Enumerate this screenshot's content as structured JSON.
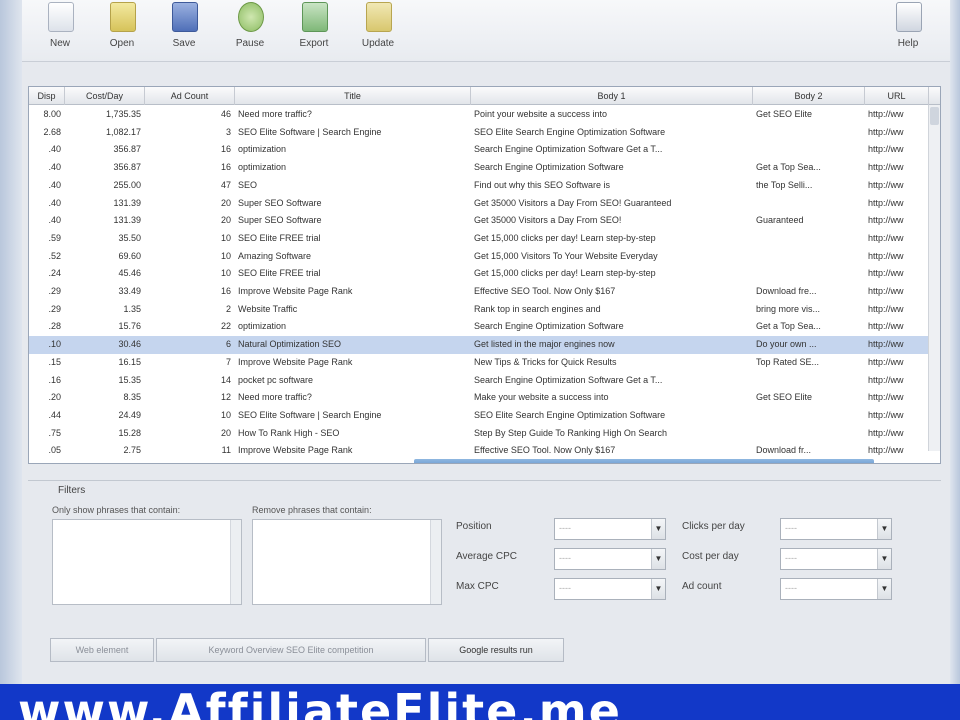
{
  "toolbar": {
    "buttons": [
      {
        "label": "New",
        "icon": "new-file-icon"
      },
      {
        "label": "Open",
        "icon": "open-folder-icon"
      },
      {
        "label": "Save",
        "icon": "save-disk-icon"
      },
      {
        "label": "Pause",
        "icon": "pause-icon"
      },
      {
        "label": "Export",
        "icon": "export-icon"
      },
      {
        "label": "Update",
        "icon": "update-icon"
      }
    ],
    "help_label": "Help"
  },
  "grid": {
    "columns": [
      "Disp",
      "Cost/Day",
      "Ad Count",
      "Title",
      "Body 1",
      "Body 2",
      "URL"
    ],
    "rows": [
      [
        "8.00",
        "1,735.35",
        "46",
        "Need more traffic?",
        "Point your website a success into",
        "Get SEO Elite",
        "http://ww"
      ],
      [
        "2.68",
        "1,082.17",
        "3",
        "SEO Elite Software | Search Engine",
        "SEO Elite Search Engine Optimization Software",
        "",
        "http://ww"
      ],
      [
        ".40",
        "356.87",
        "16",
        "optimization",
        "Search Engine Optimization Software Get a T...",
        "",
        "http://ww"
      ],
      [
        ".40",
        "356.87",
        "16",
        "optimization",
        "Search Engine Optimization Software",
        "Get a Top Sea...",
        "http://ww"
      ],
      [
        ".40",
        "255.00",
        "47",
        "SEO",
        "Find out why this SEO Software is",
        "the Top Selli...",
        "http://ww"
      ],
      [
        ".40",
        "131.39",
        "20",
        "Super SEO Software",
        "Get 35000 Visitors a Day From SEO! Guaranteed",
        "",
        "http://ww"
      ],
      [
        ".40",
        "131.39",
        "20",
        "Super SEO Software",
        "Get 35000 Visitors a Day From SEO!",
        "Guaranteed",
        "http://ww"
      ],
      [
        ".59",
        "35.50",
        "10",
        "SEO Elite FREE trial",
        "Get 15,000 clicks per day! Learn step-by-step",
        "",
        "http://ww"
      ],
      [
        ".52",
        "69.60",
        "10",
        "Amazing Software",
        "Get 15,000 Visitors To Your Website Everyday",
        "",
        "http://ww"
      ],
      [
        ".24",
        "45.46",
        "10",
        "SEO Elite FREE trial",
        "Get 15,000 clicks per day! Learn step-by-step",
        "",
        "http://ww"
      ],
      [
        ".29",
        "33.49",
        "16",
        "Improve Website Page Rank",
        "Effective SEO Tool. Now Only $167",
        "Download fre...",
        "http://ww"
      ],
      [
        ".29",
        "1.35",
        "2",
        "Website Traffic",
        "Rank top in search engines and",
        "bring more vis...",
        "http://ww"
      ],
      [
        ".28",
        "15.76",
        "22",
        "optimization",
        "Search Engine Optimization Software",
        "Get a Top Sea...",
        "http://ww"
      ],
      [
        ".10",
        "30.46",
        "6",
        "Natural Optimization SEO",
        "Get listed in the major engines now",
        "Do your own ...",
        "http://ww"
      ],
      [
        ".15",
        "16.15",
        "7",
        "Improve Website Page Rank",
        "New Tips & Tricks for Quick Results",
        "Top Rated SE...",
        "http://ww"
      ],
      [
        ".16",
        "15.35",
        "14",
        "pocket pc software",
        "Search Engine Optimization Software Get a T...",
        "",
        "http://ww"
      ],
      [
        ".20",
        "8.35",
        "12",
        "Need more traffic?",
        "Make your website a success into",
        "Get SEO Elite",
        "http://ww"
      ],
      [
        ".44",
        "24.49",
        "10",
        "SEO Elite Software | Search Engine",
        "SEO Elite Search Engine Optimization Software",
        "",
        "http://ww"
      ],
      [
        ".75",
        "15.28",
        "20",
        "How To Rank High - SEO",
        "Step By Step Guide To Ranking High On Search",
        "",
        "http://ww"
      ],
      [
        ".05",
        "2.75",
        "11",
        "Improve Website Page Rank",
        "Effective SEO Tool. Now Only $167",
        "Download fr...",
        "http://ww"
      ]
    ]
  },
  "filters": {
    "title": "Filters",
    "only_label": "Only show phrases that contain:",
    "remove_label": "Remove phrases that contain:",
    "fields": [
      {
        "label": "Position",
        "value": "----"
      },
      {
        "label": "Average CPC",
        "value": "----"
      },
      {
        "label": "Max CPC",
        "value": "----"
      },
      {
        "label": "Clicks per day",
        "value": "----"
      },
      {
        "label": "Cost per day",
        "value": "----"
      },
      {
        "label": "Ad count",
        "value": "----"
      }
    ]
  },
  "bottom_buttons": [
    "Web element",
    "Keyword Overview  SEO Elite  competition",
    "Google results run"
  ],
  "banner": {
    "text": "www.AffiliateElite.me"
  },
  "colors": {
    "banner": "#1238c8",
    "selection": "#c5d5ee",
    "scrollbar": "#5d8fcb"
  }
}
